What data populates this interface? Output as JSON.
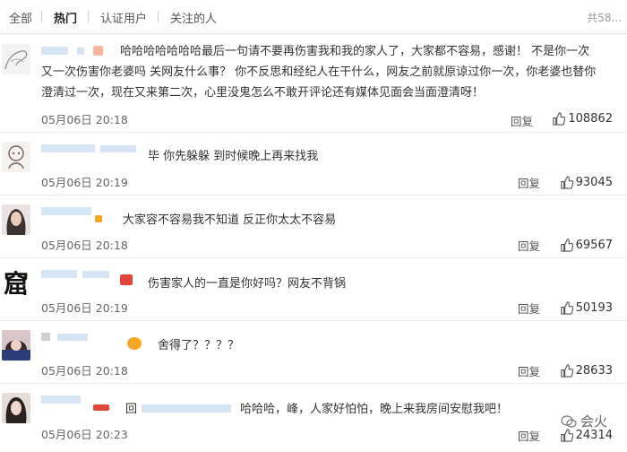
{
  "tabs": {
    "all": "全部",
    "hot": "热门",
    "verified": "认证用户",
    "following": "关注的人",
    "total": "共58..."
  },
  "comments": [
    {
      "text_lines": [
        "哈哈哈哈哈哈哈最后一句请不要再伤害我和我的家人了，大家都不容易，感谢！ 不是你一次",
        "又一次伤害你老婆吗 关网友什么事？ 你不反思和经纪人在干什么，网友之前就原谅过你一次，你老婆也替你",
        "澄清过一次，现在又来第二次，心里没鬼怎么不敢开评论还有媒体见面会当面澄清呀！"
      ],
      "time": "05月06日 20:18",
      "reply": "回复",
      "likes": "108862"
    },
    {
      "text_lines": [
        "毕 你先躲躲 到时候晚上再来找我"
      ],
      "time": "05月06日 20:19",
      "reply": "回复",
      "likes": "93045"
    },
    {
      "text_lines": [
        "大家容不容易我不知道 反正你太太不容易"
      ],
      "time": "05月06日 20:18",
      "reply": "回复",
      "likes": "69567"
    },
    {
      "avatar_char": "窟",
      "text_lines": [
        "伤害家人的一直是你好吗？网友不背锅"
      ],
      "time": "05月06日 20:19",
      "reply": "回复",
      "likes": "50193"
    },
    {
      "text_lines": [
        "舍得了？？？？"
      ],
      "time": "05月06日 20:18",
      "reply": "回复",
      "likes": "28633"
    },
    {
      "reply_prefix": "回",
      "text_lines": [
        "哈哈哈，峰，人家好怕怕，晚上来我房间安慰我吧！"
      ],
      "time": "05月06日 20:23",
      "reply": "回复",
      "likes": "24314"
    }
  ],
  "watermark": "会火",
  "colors": {
    "link": "#c6d9ee",
    "badge_orange": "#f5a623",
    "badge_red": "#e0463a"
  }
}
